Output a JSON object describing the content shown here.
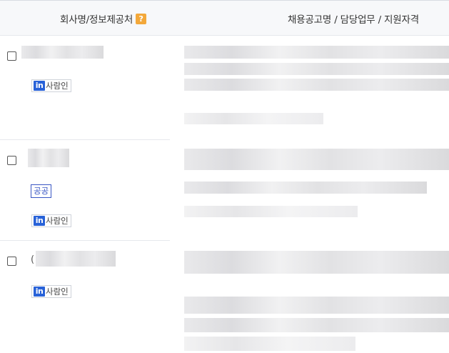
{
  "header": {
    "company_col": "회사명/정보제공처",
    "help_badge": "?",
    "job_col": "채용공고명 / 담당업무 / 지원자격"
  },
  "colors": {
    "help_badge_bg": "#f3a83a",
    "saramin_logo_bg": "#2862d8",
    "public_tag_border": "#3a57c4"
  },
  "rows": [
    {
      "source_logo": "in",
      "source_label": "사람인",
      "public_tag": ""
    },
    {
      "source_logo": "in",
      "source_label": "사람인",
      "public_tag": "공공"
    },
    {
      "source_logo": "in",
      "source_label": "사람인",
      "public_tag": "",
      "company_prefix": "("
    }
  ]
}
